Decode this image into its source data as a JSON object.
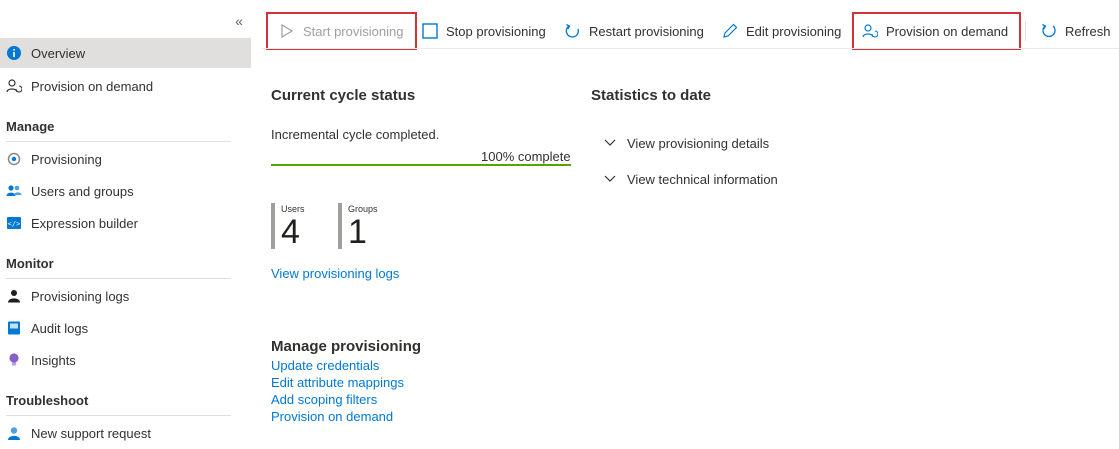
{
  "sidebar": {
    "collapse_glyph": "«",
    "top_items": [
      {
        "label": "Overview",
        "icon": "info-icon"
      },
      {
        "label": "Provision on demand",
        "icon": "person-sync-icon"
      }
    ],
    "sections": [
      {
        "title": "Manage",
        "items": [
          {
            "label": "Provisioning",
            "icon": "provisioning-icon"
          },
          {
            "label": "Users and groups",
            "icon": "users-icon"
          },
          {
            "label": "Expression builder",
            "icon": "code-icon"
          }
        ]
      },
      {
        "title": "Monitor",
        "items": [
          {
            "label": "Provisioning logs",
            "icon": "person-log-icon"
          },
          {
            "label": "Audit logs",
            "icon": "book-icon"
          },
          {
            "label": "Insights",
            "icon": "lightbulb-icon"
          }
        ]
      },
      {
        "title": "Troubleshoot",
        "items": [
          {
            "label": "New support request",
            "icon": "support-person-icon"
          }
        ]
      }
    ]
  },
  "toolbar": {
    "start": "Start provisioning",
    "stop": "Stop provisioning",
    "restart": "Restart provisioning",
    "edit": "Edit provisioning",
    "on_demand": "Provision on demand",
    "refresh": "Refresh"
  },
  "cycle": {
    "title": "Current cycle status",
    "status": "Incremental cycle completed.",
    "progress_label": "100% complete",
    "progress_fraction": 1.0
  },
  "stats": {
    "users_label": "Users",
    "users_value": "4",
    "groups_label": "Groups",
    "groups_value": "1",
    "logs_link": "View provisioning logs"
  },
  "statistics": {
    "title": "Statistics to date",
    "details": "View provisioning details",
    "technical": "View technical information"
  },
  "manage": {
    "title": "Manage provisioning",
    "links": [
      "Update credentials",
      "Edit attribute mappings",
      "Add scoping filters",
      "Provision on demand"
    ]
  },
  "colors": {
    "accent": "#0078d4",
    "highlight_border": "#d13438",
    "progress": "#57a300",
    "active_bg": "#e1dfdd"
  }
}
